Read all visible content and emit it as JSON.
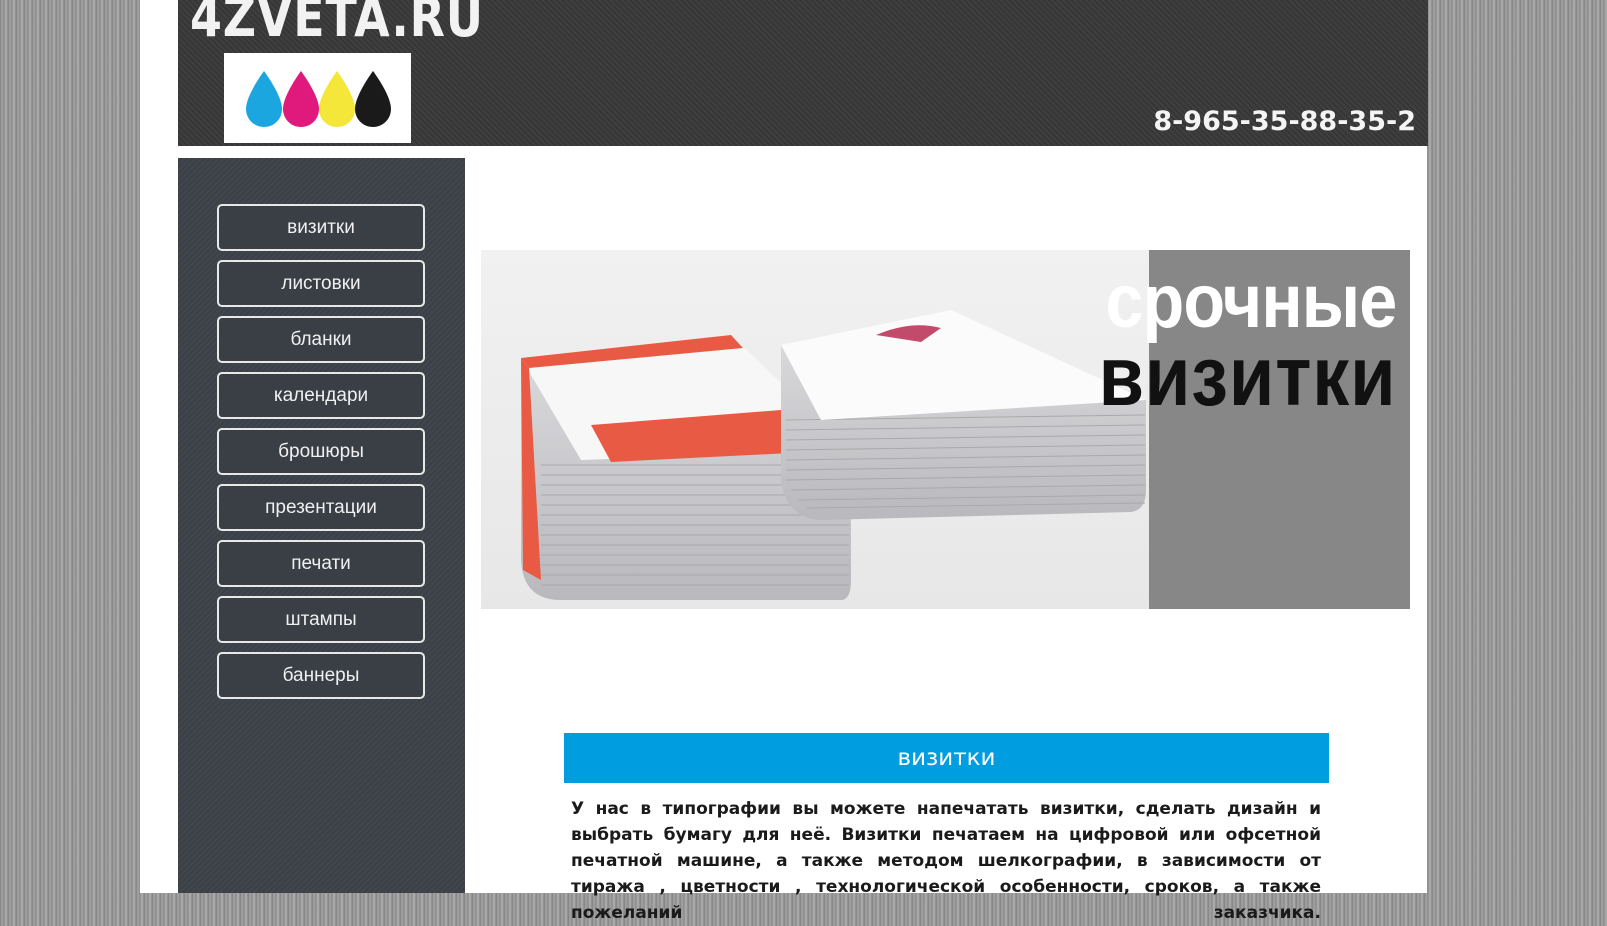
{
  "header": {
    "logo_text": "4ZVETA.RU",
    "phone": "8-965-35-88-35-2",
    "ink_colors": [
      "#1ba6e0",
      "#e0197d",
      "#f5e63a",
      "#1a1a1a"
    ]
  },
  "sidebar": {
    "items": [
      {
        "label": "визитки"
      },
      {
        "label": "листовки"
      },
      {
        "label": "бланки"
      },
      {
        "label": "календари"
      },
      {
        "label": "брошюры"
      },
      {
        "label": "презентации"
      },
      {
        "label": "печати"
      },
      {
        "label": "штампы"
      },
      {
        "label": "баннеры"
      }
    ]
  },
  "banner": {
    "line1": "срочные",
    "line2": "визитки"
  },
  "section": {
    "title": "визитки",
    "text": "У нас в типографии вы можете напечатать визитки, сделать дизайн и выбрать бумагу для неё. Визитки печатаем на цифровой или офсетной печатной машине, а также методом шелкографии, в зависимости от тиража , цветности , технологической особенности, сроков, а также пожеланий заказчика."
  },
  "colors": {
    "accent": "#009ee0",
    "header_bg": "#3a3a3a",
    "sidebar_bg": "#3e434a"
  }
}
